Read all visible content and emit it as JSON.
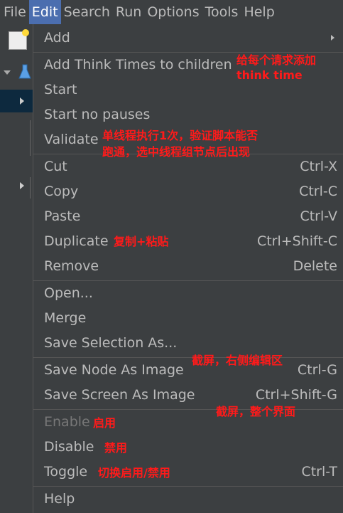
{
  "menubar": {
    "items": [
      {
        "label": "File"
      },
      {
        "label": "Edit"
      },
      {
        "label": "Search"
      },
      {
        "label": "Run"
      },
      {
        "label": "Options"
      },
      {
        "label": "Tools"
      },
      {
        "label": "Help"
      }
    ]
  },
  "edit_menu": {
    "add": {
      "label": "Add"
    },
    "add_think_times": {
      "label": "Add Think Times to children"
    },
    "start": {
      "label": "Start"
    },
    "start_no_pauses": {
      "label": "Start no pauses"
    },
    "validate": {
      "label": "Validate"
    },
    "cut": {
      "label": "Cut",
      "shortcut": "Ctrl-X"
    },
    "copy": {
      "label": "Copy",
      "shortcut": "Ctrl-C"
    },
    "paste": {
      "label": "Paste",
      "shortcut": "Ctrl-V"
    },
    "duplicate": {
      "label": "Duplicate",
      "shortcut": "Ctrl+Shift-C"
    },
    "remove": {
      "label": "Remove",
      "shortcut": "Delete"
    },
    "open": {
      "label": "Open..."
    },
    "merge": {
      "label": "Merge"
    },
    "save_selection_as": {
      "label": "Save Selection As..."
    },
    "save_node_as_image": {
      "label": "Save Node As Image",
      "shortcut": "Ctrl-G"
    },
    "save_screen_as_image": {
      "label": "Save Screen As Image",
      "shortcut": "Ctrl+Shift-G"
    },
    "enable": {
      "label": "Enable"
    },
    "disable": {
      "label": "Disable"
    },
    "toggle": {
      "label": "Toggle",
      "shortcut": "Ctrl-T"
    },
    "help": {
      "label": "Help"
    }
  },
  "annotations": {
    "think_time_line1": "给每个请求添加",
    "think_time_line2": "think time",
    "validate_line1": "单线程执行1次，验证脚本能否",
    "validate_line2": "跑通，选中线程组节点后出现",
    "duplicate_note": "复制+粘贴",
    "save_node_note": "截屏，右侧编辑区",
    "save_screen_note": "截屏，整个界面",
    "enable_note": "启用",
    "disable_note": "禁用",
    "toggle_note": "切换启用/禁用"
  },
  "colors": {
    "background": "#3c3f41",
    "menu_highlight": "#4b6eaf",
    "text": "#bbbbbb",
    "disabled_text": "#777777",
    "annotation": "#ff1a1a"
  }
}
